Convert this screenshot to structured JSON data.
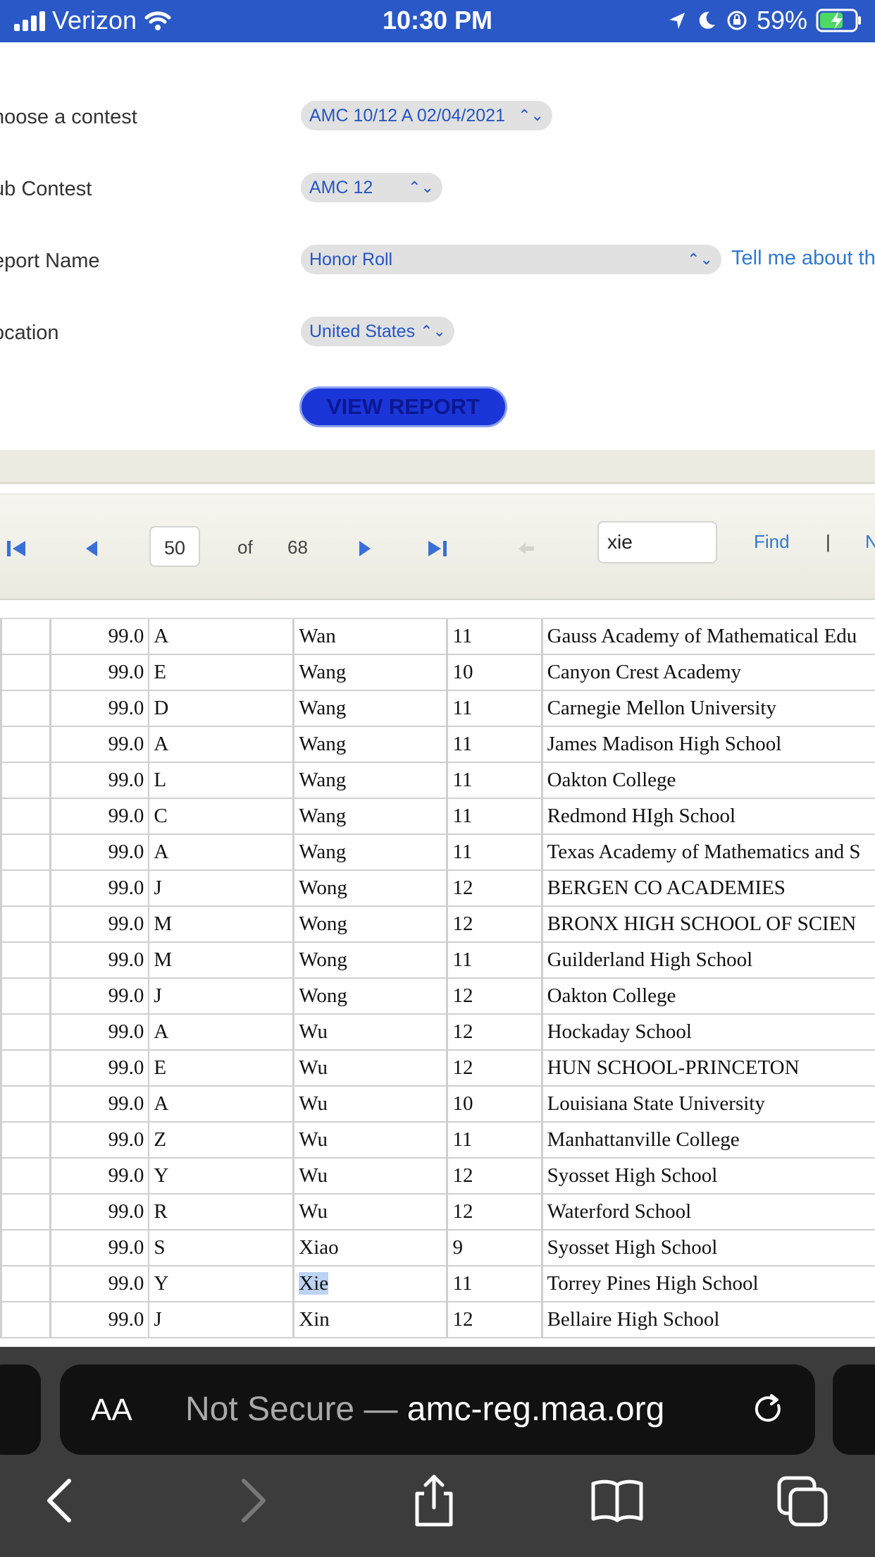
{
  "status": {
    "carrier": "Verizon",
    "time": "10:30 PM",
    "battery": "59%"
  },
  "form": {
    "contest_label": "hoose a contest",
    "contest_value": "AMC 10/12 A 02/04/2021",
    "subcontest_label": "ub Contest",
    "subcontest_value": "AMC 12",
    "report_label": "eport Name",
    "report_value": "Honor Roll",
    "report_help": "Tell me about th",
    "location_label": "ocation",
    "location_value": "United States",
    "view_button": "VIEW REPORT"
  },
  "toolbar": {
    "page": "50",
    "of": "of",
    "total_pages": "68",
    "find_value": "xie",
    "find_label": "Find",
    "separator": "|",
    "next_label": "N"
  },
  "table": {
    "rows": [
      [
        "",
        "99.0",
        "A",
        "Wan",
        "11",
        "Gauss Academy of Mathematical Edu"
      ],
      [
        "",
        "99.0",
        "E",
        "Wang",
        "10",
        "Canyon Crest Academy"
      ],
      [
        "",
        "99.0",
        "D",
        "Wang",
        "11",
        "Carnegie Mellon University"
      ],
      [
        "",
        "99.0",
        "A",
        "Wang",
        "11",
        "James Madison High School"
      ],
      [
        "",
        "99.0",
        "L",
        "Wang",
        "11",
        "Oakton College"
      ],
      [
        "",
        "99.0",
        "C",
        "Wang",
        "11",
        "Redmond HIgh School"
      ],
      [
        "",
        "99.0",
        "A",
        "Wang",
        "11",
        "Texas Academy of Mathematics and S"
      ],
      [
        "",
        "99.0",
        "J",
        "Wong",
        "12",
        "BERGEN CO ACADEMIES"
      ],
      [
        "",
        "99.0",
        "M",
        "Wong",
        "12",
        "BRONX HIGH SCHOOL OF SCIEN"
      ],
      [
        "",
        "99.0",
        "M",
        "Wong",
        "11",
        "Guilderland High School"
      ],
      [
        "",
        "99.0",
        "J",
        "Wong",
        "12",
        "Oakton College"
      ],
      [
        "",
        "99.0",
        "A",
        "Wu",
        "12",
        "Hockaday School"
      ],
      [
        "",
        "99.0",
        "E",
        "Wu",
        "12",
        "HUN SCHOOL-PRINCETON"
      ],
      [
        "",
        "99.0",
        "A",
        "Wu",
        "10",
        "Louisiana State University"
      ],
      [
        "",
        "99.0",
        "Z",
        "Wu",
        "11",
        "Manhattanville College"
      ],
      [
        "",
        "99.0",
        "Y",
        "Wu",
        "12",
        "Syosset High School"
      ],
      [
        "",
        "99.0",
        "R",
        "Wu",
        "12",
        "Waterford School"
      ],
      [
        "",
        "99.0",
        "S",
        "Xiao",
        "9",
        "Syosset High School"
      ],
      [
        "",
        "99.0",
        "Y",
        "Xie",
        "11",
        "Torrey Pines High School"
      ],
      [
        "",
        "99.0",
        "J",
        "Xin",
        "12",
        "Bellaire High School"
      ]
    ],
    "highlight_row": 18
  },
  "browser": {
    "text_size": "AA",
    "url_prefix": "Not Secure — ",
    "url_domain": "amc-reg.maa.org"
  },
  "colors": {
    "status_bar": "#2a58c7",
    "link": "#2f79d2",
    "button": "#1a35d8",
    "highlight": "#bcd3f3"
  },
  "icons": [
    "signal-icon",
    "wifi-icon",
    "location-icon",
    "moon-icon",
    "rotation-lock-icon",
    "battery-icon",
    "first-page-icon",
    "prev-page-icon",
    "next-page-icon",
    "last-page-icon",
    "back-icon",
    "reload-icon",
    "share-icon",
    "bookmarks-icon",
    "tabs-icon"
  ]
}
